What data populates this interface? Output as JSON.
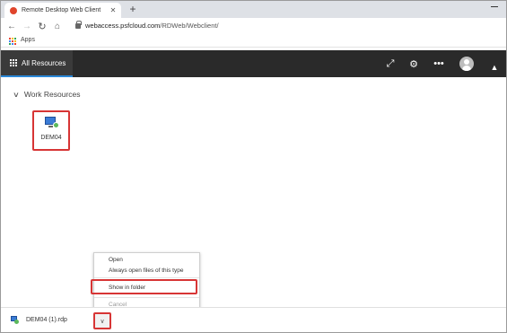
{
  "browser": {
    "tab_title": "Remote Desktop Web Client",
    "tab_close": "✕",
    "new_tab": "+",
    "url_host": "webaccess.psfcloud.com",
    "url_path": "/RDWeb/Webclient/",
    "bookmarks": {
      "apps_label": "Apps"
    },
    "nav": {
      "back": "←",
      "forward": "→",
      "reload": "↻",
      "home": "⌂"
    }
  },
  "header": {
    "all_resources_label": "All Resources",
    "icons": {
      "expand": "⤢",
      "settings": "⚙",
      "more": "•••",
      "collapse": "▲"
    }
  },
  "main": {
    "section_title": "Work Resources",
    "section_chevron": "∨",
    "resources": [
      {
        "label": "DEM04",
        "icon": "remote-desktop-icon"
      }
    ]
  },
  "context_menu": {
    "items": [
      "Open",
      "Always open files of this type",
      "Show in folder",
      "Cancel"
    ]
  },
  "download_bar": {
    "file_name": "DEM04 (1).rdp",
    "menu_chevron": "∨"
  },
  "colors": {
    "highlight": "#d73535",
    "header_bg": "#2a2a2a",
    "accent": "#2b88d8"
  }
}
